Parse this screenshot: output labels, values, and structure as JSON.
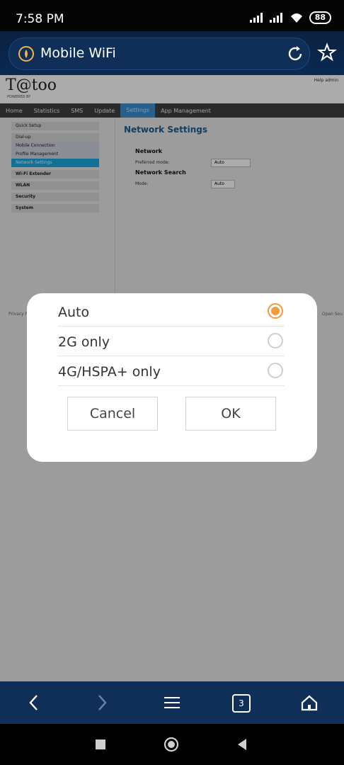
{
  "status": {
    "time": "7:58 PM",
    "battery": "88"
  },
  "browser": {
    "page_title": "Mobile WiFi"
  },
  "web": {
    "brand": "T@too",
    "brand_sub": "POWERED BY",
    "help_links": "Help   admin",
    "nav": [
      "Home",
      "Statistics",
      "SMS",
      "Update",
      "Settings",
      "App Management"
    ],
    "sidebar": [
      "Quick Setup",
      "Dial-up",
      "Mobile Connection",
      "Profile Management",
      "Network Settings",
      "Wi-Fi Extender",
      "WLAN",
      "Security",
      "System"
    ],
    "panel_title": "Network Settings",
    "network_label": "Network",
    "preferred_mode_label": "Preferred mode:",
    "preferred_mode_value": "Auto",
    "network_search_label": "Network Search",
    "mode_label": "Mode:",
    "mode_value": "Auto",
    "footer_left": "Privacy P",
    "footer_right": "Open Sou"
  },
  "dialog": {
    "options": [
      "Auto",
      "2G only",
      "4G/HSPA+ only"
    ],
    "selected_index": 0,
    "cancel_label": "Cancel",
    "ok_label": "OK"
  },
  "bottom_nav": {
    "tabs_count": "3"
  }
}
